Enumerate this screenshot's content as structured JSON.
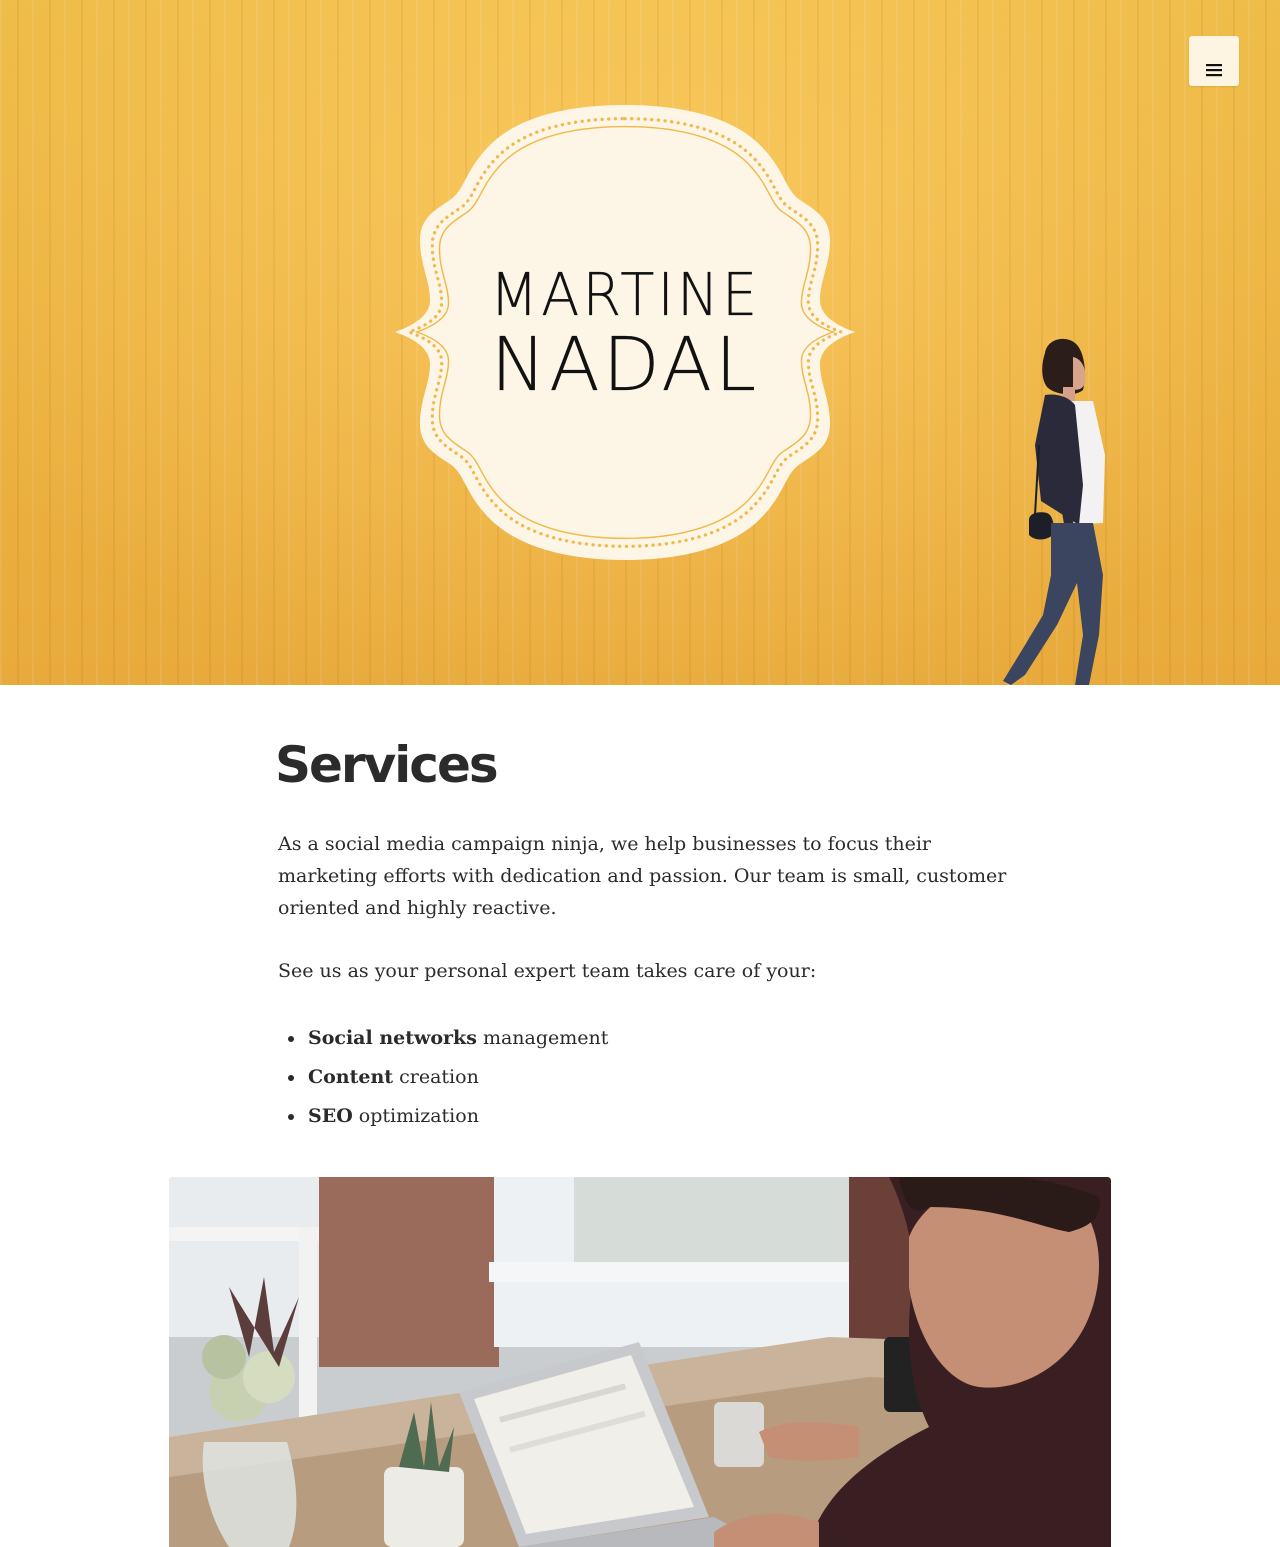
{
  "header": {
    "menu_icon": "hamburger-icon",
    "logo": {
      "line1": "MARTINE",
      "line2": "NADAL"
    }
  },
  "main": {
    "title": "Services",
    "paragraphs": [
      "As a social media campaign ninja, we help businesses to focus their marketing efforts with dedication and passion. Our team is small, customer oriented and highly reactive.",
      "See us as your personal expert team takes care of your:"
    ],
    "services": [
      {
        "bold": "Social networks",
        "rest": " management"
      },
      {
        "bold": "Content",
        "rest": " creation"
      },
      {
        "bold": "SEO",
        "rest": " optimization"
      }
    ]
  },
  "colors": {
    "hero_yellow": "#f8bd45",
    "badge_cream": "#fdf6e6",
    "badge_dots": "#f2b84a",
    "text": "#2b2b2b"
  }
}
